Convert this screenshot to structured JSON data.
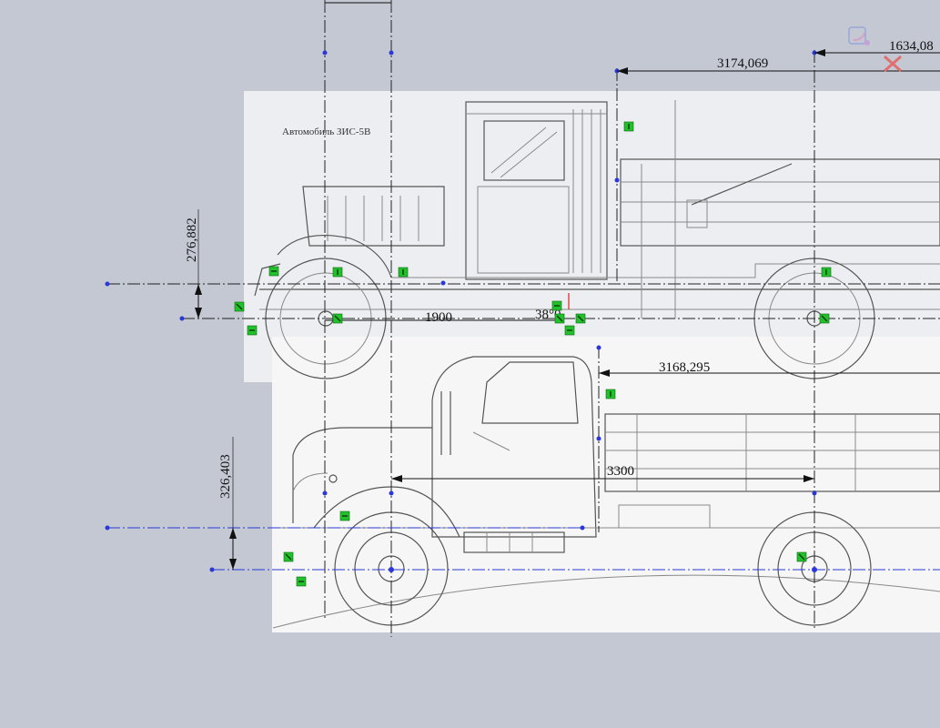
{
  "sketch": {
    "caption_top_image": "Автомобиль ЗИС-5В",
    "dimensions": {
      "top_horizontal_1": "3174,069",
      "top_horizontal_2": "1634,08",
      "vertical_left_top": "276,882",
      "wheelbase_top": "1900",
      "mid_text": "38°0",
      "horizontal_middle": "3168,295",
      "wheelbase_bottom": "3300",
      "vertical_left_bottom": "326,403",
      "offscreen_top": "…"
    },
    "colors": {
      "background": "#c3c8d2",
      "sketch_blue": "#2a38d8",
      "relation_green": "#22c02a",
      "dimension_black": "#111111"
    },
    "icons": [
      "rotate-view-icon",
      "close-cross-icon"
    ]
  }
}
